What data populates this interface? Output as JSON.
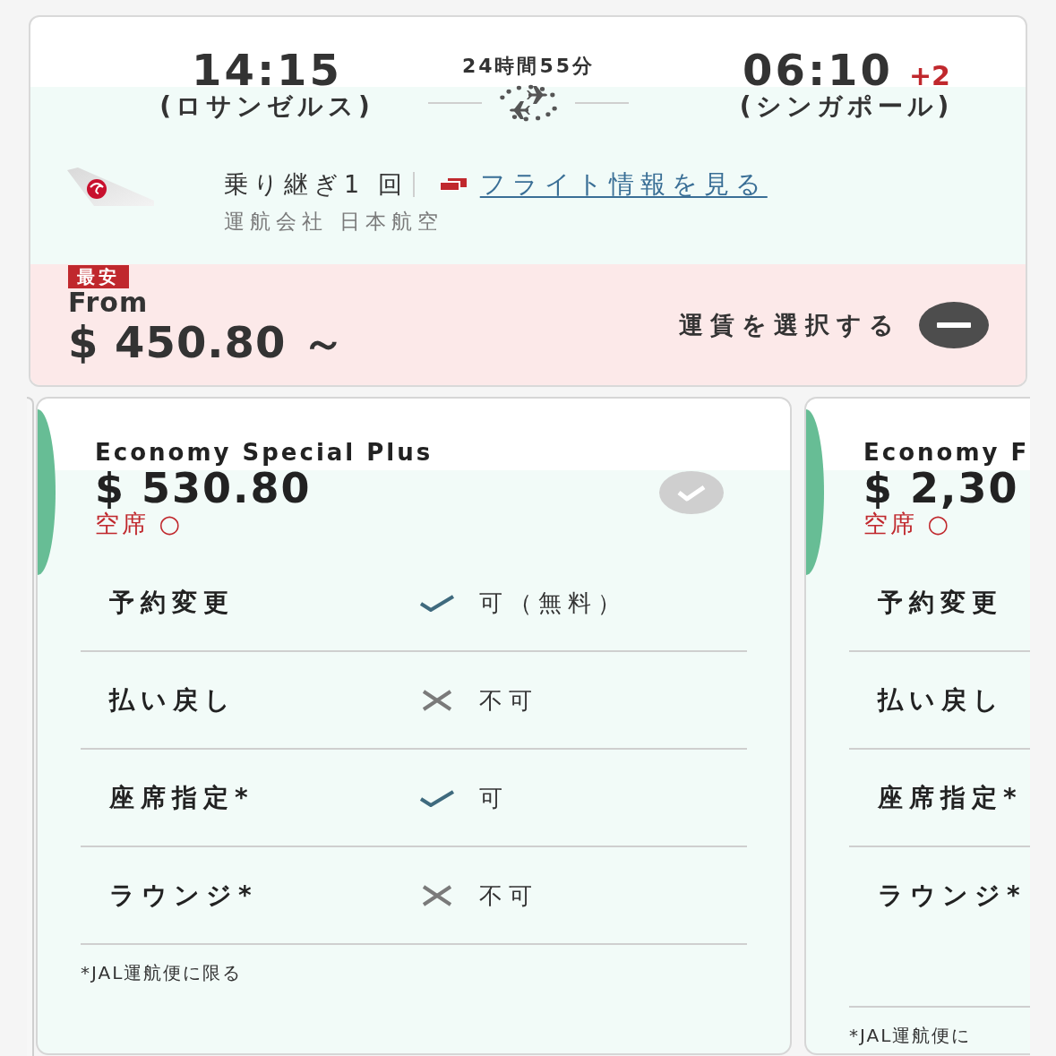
{
  "flight": {
    "departure": {
      "time": "14:15",
      "place": "(ロサンゼルス)"
    },
    "duration": "24時間55分",
    "arrival": {
      "time": "06:10",
      "day_offset": "+2",
      "place": "(シンガポール)"
    },
    "transfers": "乗り継ぎ1 回",
    "info_link": "フライト情報を見る",
    "operator": "運航会社 日本航空"
  },
  "lowest_fare": {
    "badge": "最安",
    "from_label": "From",
    "price": "$ 450.80 ～",
    "select_label": "運賃を選択する",
    "expanded": true
  },
  "fares": [
    {
      "name": "Economy Special Plus",
      "price": "$ 530.80",
      "availability": "空席 ○",
      "selected": false,
      "rules": [
        {
          "label": "予約変更",
          "allowed": true,
          "value": "可（無料）"
        },
        {
          "label": "払い戻し",
          "allowed": false,
          "value": "不可"
        },
        {
          "label": "座席指定*",
          "allowed": true,
          "value": "可"
        },
        {
          "label": "ラウンジ*",
          "allowed": false,
          "value": "不可"
        }
      ],
      "note": "*JAL運航便に限る"
    },
    {
      "name": "Economy F",
      "price": "$ 2,30",
      "availability": "空席 ○",
      "rules": [
        {
          "label": "予約変更"
        },
        {
          "label": "払い戻し"
        },
        {
          "label": "座席指定*"
        },
        {
          "label": "ラウンジ*"
        }
      ],
      "note": "*JAL運航便に"
    }
  ]
}
